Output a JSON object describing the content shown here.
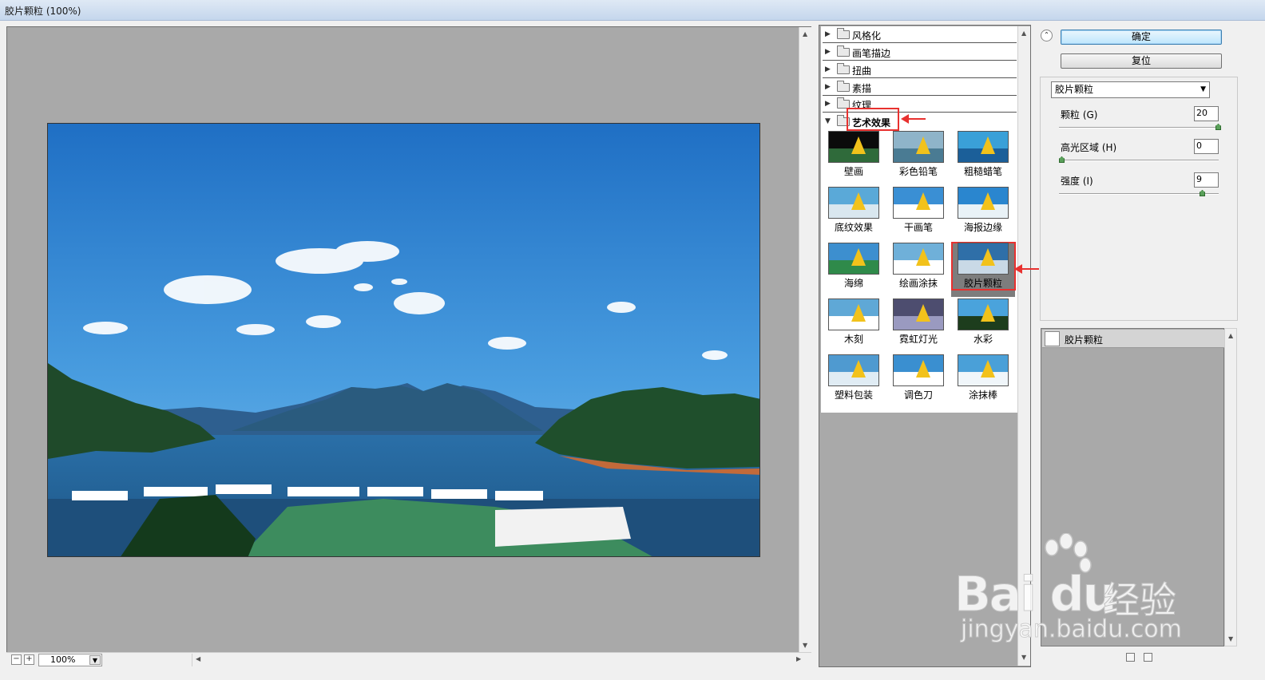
{
  "window": {
    "title": "胶片颗粒 (100%)"
  },
  "preview": {
    "zoom": "100%",
    "zoom_out": "−",
    "zoom_in": "+"
  },
  "gallery": {
    "categories": [
      {
        "label": "风格化",
        "expanded": false
      },
      {
        "label": "画笔描边",
        "expanded": false
      },
      {
        "label": "扭曲",
        "expanded": false
      },
      {
        "label": "素描",
        "expanded": false
      },
      {
        "label": "纹理",
        "expanded": false
      },
      {
        "label": "艺术效果",
        "expanded": true
      }
    ],
    "filters": [
      {
        "label": "壁画"
      },
      {
        "label": "彩色铅笔"
      },
      {
        "label": "粗糙蜡笔"
      },
      {
        "label": "底纹效果"
      },
      {
        "label": "干画笔"
      },
      {
        "label": "海报边缘"
      },
      {
        "label": "海绵"
      },
      {
        "label": "绘画涂抹"
      },
      {
        "label": "胶片颗粒"
      },
      {
        "label": "木刻"
      },
      {
        "label": "霓虹灯光"
      },
      {
        "label": "水彩"
      },
      {
        "label": "塑料包装"
      },
      {
        "label": "调色刀"
      },
      {
        "label": "涂抹棒"
      }
    ],
    "selected_filter": "胶片颗粒"
  },
  "settings": {
    "ok_label": "确定",
    "reset_label": "复位",
    "filter_select": "胶片颗粒",
    "params": [
      {
        "label": "颗粒 (G)",
        "value": "20",
        "level": 1.0
      },
      {
        "label": "高光区域 (H)",
        "value": "0",
        "level": 0.0
      },
      {
        "label": "强度 (I)",
        "value": "9",
        "level": 0.9
      }
    ]
  },
  "layers": {
    "items": [
      {
        "label": "胶片颗粒"
      }
    ]
  },
  "watermark": {
    "brand": "Bai du",
    "cn": "经验",
    "url": "jingyan.baidu.com"
  },
  "colors": {
    "highlight": "#e8312f",
    "primary_button": "#bee6fd"
  }
}
